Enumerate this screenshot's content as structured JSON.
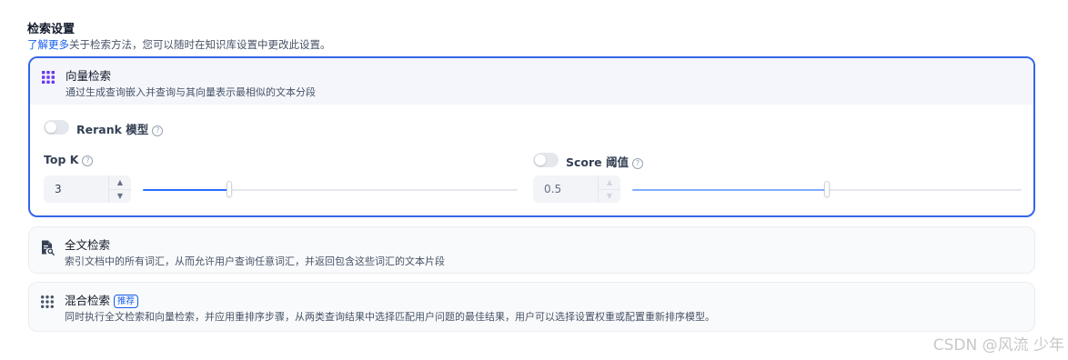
{
  "header": {
    "title": "检索设置",
    "learn_more": "了解更多",
    "subtitle_rest": "关于检索方法，您可以随时在知识库设置中更改此设置。"
  },
  "methods": [
    {
      "name": "向量检索",
      "desc": "通过生成查询嵌入并查询与其向量表示最相似的文本分段",
      "icon": "grid-icon",
      "selected": true
    },
    {
      "name": "全文检索",
      "desc": "索引文档中的所有词汇，从而允许用户查询任意词汇，并返回包含这些词汇的文本片段",
      "icon": "document-search-icon",
      "selected": false
    },
    {
      "name": "混合检索",
      "badge": "推荐",
      "desc": "同时执行全文检索和向量检索，并应用重排序步骤，从两类查询结果中选择匹配用户问题的最佳结果，用户可以选择设置权重或配置重新排序模型。",
      "icon": "grid-icon",
      "selected": false
    }
  ],
  "vector_settings": {
    "rerank_label": "Rerank 模型",
    "rerank_enabled": false,
    "topk_label": "Top K",
    "topk_value": "3",
    "topk_fraction": 0.23,
    "score_label": "Score 阈值",
    "score_enabled": false,
    "score_value": "0.5",
    "score_fraction": 0.5
  },
  "icons": {
    "help": "?",
    "up": "▲",
    "down": "▼"
  },
  "colors": {
    "accent": "#296dff",
    "border_active": "#3366e8",
    "link": "#155eef"
  },
  "watermark": "CSDN @风流 少年"
}
